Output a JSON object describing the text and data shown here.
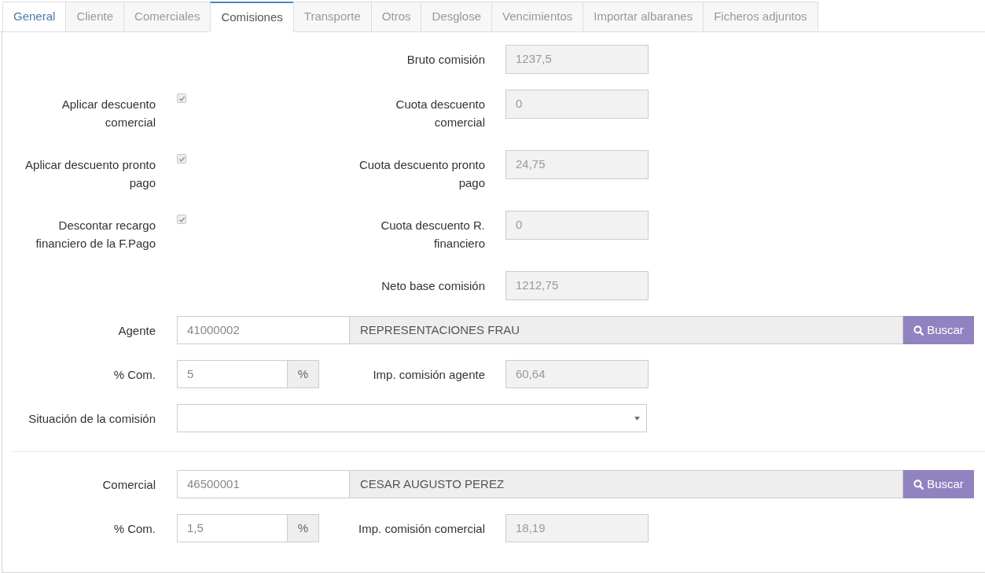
{
  "tabs": [
    {
      "label": "General",
      "selected": false,
      "highlighted": true
    },
    {
      "label": "Cliente",
      "selected": false,
      "highlighted": false
    },
    {
      "label": "Comerciales",
      "selected": false,
      "highlighted": false
    },
    {
      "label": "Comisiones",
      "selected": true,
      "highlighted": false
    },
    {
      "label": "Transporte",
      "selected": false,
      "highlighted": false
    },
    {
      "label": "Otros",
      "selected": false,
      "highlighted": false
    },
    {
      "label": "Desglose",
      "selected": false,
      "highlighted": false
    },
    {
      "label": "Vencimientos",
      "selected": false,
      "highlighted": false
    },
    {
      "label": "Importar albaranes",
      "selected": false,
      "highlighted": false
    },
    {
      "label": "Ficheros adjuntos",
      "selected": false,
      "highlighted": false
    }
  ],
  "commission_summary": [
    {
      "kind": "plain",
      "field": {
        "label": "Bruto comisión",
        "value": "1237,5"
      }
    },
    {
      "kind": "with_checkbox",
      "checkbox": {
        "label": "Aplicar descuento comercial",
        "checked": true,
        "disabled": true
      },
      "field": {
        "label": "Cuota descuento comercial",
        "value": "0"
      }
    },
    {
      "kind": "with_checkbox",
      "checkbox": {
        "label": "Aplicar descuento pronto pago",
        "checked": true,
        "disabled": true
      },
      "field": {
        "label": "Cuota descuento pronto pago",
        "value": "24,75"
      }
    },
    {
      "kind": "with_checkbox",
      "checkbox": {
        "label": "Descontar recargo financiero de la F.Pago",
        "checked": true,
        "disabled": true
      },
      "field": {
        "label": "Cuota descuento R. financiero",
        "value": "0"
      }
    },
    {
      "kind": "plain",
      "field": {
        "label": "Neto base comisión",
        "value": "1212,75"
      }
    }
  ],
  "agent": {
    "label": "Agente",
    "code": "41000002",
    "name": "REPRESENTACIONES FRAU",
    "search_button": "Buscar"
  },
  "agent_commission": {
    "label": "% Com.",
    "value": "5",
    "unit": "%",
    "amount_label": "Imp. comisión agente",
    "amount": "60,64"
  },
  "commission_status": {
    "label": "Situación de la comisión"
  },
  "sales_rep": {
    "label": "Comercial",
    "code": "46500001",
    "name": "CESAR AUGUSTO PEREZ",
    "search_button": "Buscar"
  },
  "sales_rep_commission": {
    "label": "% Com.",
    "value": "1,5",
    "unit": "%",
    "amount_label": "Imp. comisión comercial",
    "amount": "18,19"
  }
}
